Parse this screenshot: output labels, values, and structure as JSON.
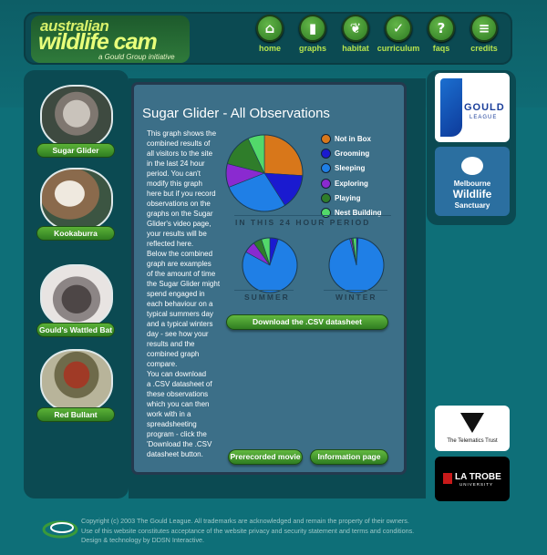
{
  "logo": {
    "line1": "australian",
    "line2": "wildlife cam",
    "tagline": "a Gould Group initiative"
  },
  "nav": [
    {
      "label": "home",
      "icon": "home-icon",
      "glyph": "⌂"
    },
    {
      "label": "graphs",
      "icon": "bar-graph-icon",
      "glyph": "▮"
    },
    {
      "label": "habitat",
      "icon": "leaf-icon",
      "glyph": "❦"
    },
    {
      "label": "curriculum",
      "icon": "checkmark-icon",
      "glyph": "✓"
    },
    {
      "label": "faqs",
      "icon": "question-icon",
      "glyph": "?"
    },
    {
      "label": "credits",
      "icon": "list-icon",
      "glyph": "≡"
    }
  ],
  "animals": [
    {
      "name": "Sugar Glider",
      "icon": "sugar-glider-photo"
    },
    {
      "name": "Kookaburra",
      "icon": "kookaburra-photo"
    },
    {
      "name": "Gould's Wattled Bat",
      "icon": "bat-photo"
    },
    {
      "name": "Red Bullant",
      "icon": "ant-photo"
    }
  ],
  "main": {
    "title": "Sugar Glider - All Observations",
    "description": [
      "This graph shows the",
      "combined results of",
      "all visitors to the site",
      "in the last 24 hour",
      "period. You can't",
      "modify this graph",
      "here but if you record",
      "observations on the",
      "graphs on the Sugar",
      "Glider's video page,",
      "your results will be",
      "reflected here.",
      "Below the combined",
      "graph are examples",
      "of the amount of time",
      "the Sugar Glider might",
      "spend engaged in",
      "each behaviour on a",
      "typical summers day",
      "and a typical winters",
      "day - see how your",
      "results and the",
      "combined graph",
      "compare.",
      "You can download",
      "a .CSV datasheet of",
      "these observations",
      "which you can then",
      "work with in a",
      "spreadsheeting",
      "program - click the",
      "'Download the .CSV",
      "datasheet button."
    ],
    "main_caption": "IN THIS 24 HOUR PERIOD",
    "summer_caption": "SUMMER",
    "winter_caption": "WINTER",
    "download_label": "Download the .CSV datasheet",
    "prerecorded_label": "Prerecorded movie",
    "info_label": "Information page"
  },
  "legend": [
    {
      "label": "Not in Box",
      "color": "#d8771a"
    },
    {
      "label": "Grooming",
      "color": "#1a1ad0"
    },
    {
      "label": "Sleeping",
      "color": "#1f7fe6"
    },
    {
      "label": "Exploring",
      "color": "#8a2ad0"
    },
    {
      "label": "Playing",
      "color": "#2f7d2a"
    },
    {
      "label": "Nest Building",
      "color": "#52d86a"
    }
  ],
  "chart_data": [
    {
      "type": "pie",
      "title": "IN THIS 24 HOUR PERIOD",
      "categories": [
        "Not in Box",
        "Grooming",
        "Sleeping",
        "Exploring",
        "Playing",
        "Nest Building"
      ],
      "values": [
        26,
        15,
        28,
        10,
        14,
        7
      ]
    },
    {
      "type": "pie",
      "title": "SUMMER",
      "categories": [
        "Not in Box",
        "Grooming",
        "Sleeping",
        "Exploring",
        "Playing",
        "Nest Building"
      ],
      "values": [
        0,
        5,
        78,
        7,
        5,
        5
      ]
    },
    {
      "type": "pie",
      "title": "WINTER",
      "categories": [
        "Not in Box",
        "Grooming",
        "Sleeping",
        "Exploring",
        "Playing",
        "Nest Building"
      ],
      "values": [
        0,
        1,
        95,
        1,
        1,
        2
      ]
    }
  ],
  "sponsors": {
    "gould_line1": "GOULD",
    "gould_line2": "LEAGUE",
    "sanctuary_line1": "Melbourne",
    "sanctuary_line2": "Wildlife",
    "sanctuary_line3": "Sanctuary",
    "telematics": "The Telematics Trust",
    "latrobe_line1": "LA TROBE",
    "latrobe_line2": "UNIVERSITY"
  },
  "footer": [
    "Copyright (c) 2003 The Gould League. All trademarks are acknowledged and remain the property of their owners.",
    "Use of this website constitutes acceptance of the website privacy and security statement and terms and conditions.",
    "Design & technology by DDSN Interactive."
  ]
}
